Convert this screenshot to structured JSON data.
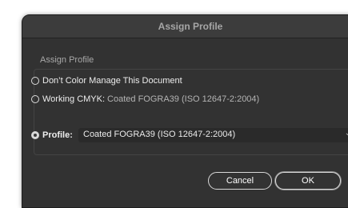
{
  "dialog": {
    "title": "Assign Profile",
    "group_label": "Assign Profile",
    "options": {
      "dont_manage": {
        "label": "Don’t Color Manage This Document"
      },
      "working_cmyk": {
        "label": "Working CMYK:",
        "value": "Coated FOGRA39 (ISO 12647-2:2004)"
      },
      "profile": {
        "label": "Profile:",
        "selected_value": "Coated FOGRA39 (ISO 12647-2:2004)"
      }
    },
    "selected_option": "profile",
    "buttons": {
      "cancel": "Cancel",
      "ok": "OK"
    }
  },
  "colors": {
    "dialog_bg": "#323232",
    "titlebar_bg": "#3c3c3c",
    "text": "#ededed",
    "muted_text": "#a8a8a8"
  },
  "icons": {
    "dropdown": "chevron-down-icon"
  }
}
